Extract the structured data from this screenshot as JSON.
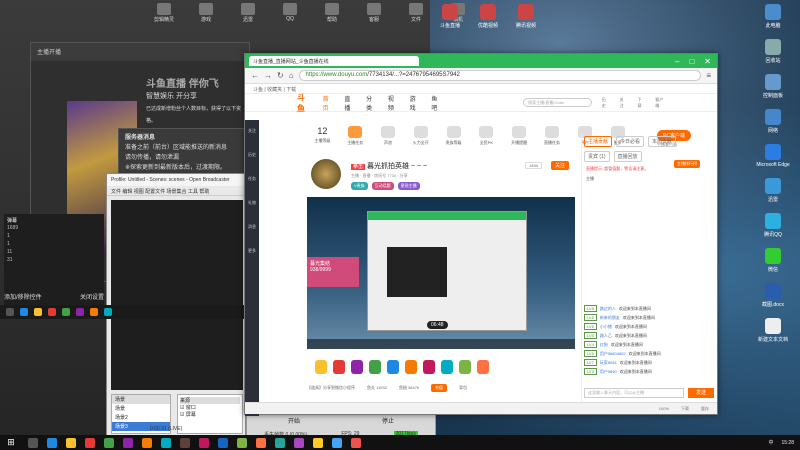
{
  "desktop": {
    "top_icons": [
      "剪辑精灵",
      "游戏",
      "迅雷",
      "QQ",
      "帮助",
      "客服",
      "文件",
      "相机",
      "直播",
      "微信"
    ],
    "right_icons": [
      "此电脑",
      "回收站",
      "控制面板",
      "网络",
      "Microsoft Edge",
      "迅雷",
      "腾讯QQ",
      "微信",
      "截图.docx",
      "新建文本文档"
    ],
    "mid_icons": [
      "斗鱼直播",
      "优酷视频",
      "腾讯视频"
    ],
    "left_icons": [
      "截图.docx",
      "新建文本文档"
    ]
  },
  "dark_window": {
    "title": "主播开播",
    "big_text": "斗鱼直播 伴你飞",
    "line1": "智慧娱乐 开分享",
    "line2": "已达成新增粉丝个人数目标，获得了以下资格。"
  },
  "notice": {
    "title": "服务器消息",
    "line1": "准备之前（前台）区域能推送的新消息",
    "line2": "请勿传播，请勿泄漏",
    "line3": "※探索更新到最新版本后，过渡期限。"
  },
  "obs": {
    "title": "Profile: Untitled - Scenes: scenes - Open Broadcaster",
    "menu": "文件  编辑  视图  配置文件  场景集合  工具  帮助",
    "scenes_header": "场景",
    "scenes": [
      "场景",
      "场景2",
      "场景3"
    ],
    "sources_header": "来源",
    "sources": [
      "窗口",
      "屏幕"
    ],
    "start_label": "开始",
    "stop_label": "停止",
    "status_time": "0:00:31 (LIVE)",
    "dropped": "丢失帧数 0 (0.00%)",
    "fps": "FPS: 29",
    "bitrate": "2017kb/s"
  },
  "left_panel": {
    "title": "弹幕",
    "rows": [
      "1689",
      "1",
      "1",
      "11",
      "31",
      "21",
      "主播"
    ],
    "buttons": [
      "添加/移除控件",
      "关闭设置"
    ]
  },
  "browser": {
    "tab_title": "斗鱼直播_直播网站_斗鱼直播在线",
    "url_host": "https://www.douyu.com",
    "url_path": "/7734134/...?=24767954695S7942",
    "bookmarks": "斗鱼 | 收藏夹 | 下载"
  },
  "site": {
    "logo": "斗鱼",
    "nav": [
      "首页",
      "直播",
      "分类",
      "视频",
      "游戏",
      "鱼吧"
    ],
    "search_placeholder": "搜索主播/直播/Order",
    "header_icons": [
      "历史",
      "关注",
      "下载",
      "客户端"
    ],
    "dock": [
      "关注",
      "历史",
      "任务",
      "礼物",
      "消息",
      "更多"
    ],
    "categories": [
      {
        "num": "12",
        "label": "主播等级"
      },
      {
        "num": "",
        "label": "主播任务"
      },
      {
        "num": "",
        "label": "声浪"
      },
      {
        "num": "",
        "label": "火力全开"
      },
      {
        "num": "",
        "label": "贵族等级"
      },
      {
        "num": "",
        "label": "全民PK"
      },
      {
        "num": "",
        "label": "开播提醒"
      },
      {
        "num": "",
        "label": "直播任务"
      },
      {
        "num": "",
        "label": "开户"
      },
      {
        "num": "",
        "label": "更多"
      }
    ],
    "pc_button": "PC客户端",
    "pc_sub": "主播客户端"
  },
  "room": {
    "tag": "拳击",
    "title": "暮光抓拍英雄 ~ ~ ~",
    "hot": "1494",
    "follow": "关注",
    "meta": "主播 · 直播 · 房间号 7734 · 分享",
    "badges": [
      "V贵族",
      "互动话题",
      "星锐主播"
    ],
    "badge_colors": [
      "#3aa",
      "#d04a7a",
      "#8a5ad0"
    ]
  },
  "player": {
    "overlay_title": "暮光集结",
    "overlay_count": "938/9999",
    "time": "06:48",
    "inner_clock": "15:29"
  },
  "under_player": {
    "text": "【道具】分享到微信小程序",
    "count1": "鱼丸 11932",
    "count2": "鱼翅 3647k",
    "btn1": "充值",
    "btn2": "背包"
  },
  "chat": {
    "tabs": [
      "主播贡献",
      "今日必看",
      "本周贡献",
      "贵宾 (1)",
      "直播回放"
    ],
    "rank_label": "主播排行榜",
    "notice": "直播提示: 超管值勤，警告请注意。",
    "top_user": "主播",
    "messages": [
      {
        "lv": "LV8",
        "user": "路过的人",
        "text": "欢迎来到本直播间"
      },
      {
        "lv": "LV8",
        "user": "新来的朋友",
        "text": "欢迎来到本直播间"
      },
      {
        "lv": "LV6",
        "user": "小小猪",
        "text": "欢迎来到本直播间"
      },
      {
        "lv": "LV5",
        "user": "路人乙",
        "text": "欢迎来到本直播间"
      },
      {
        "lv": "LV4",
        "user": "红狗",
        "text": "欢迎来到本直播间"
      },
      {
        "lv": "LV8",
        "user": "用户56804802",
        "text": "欢迎来到本直播间"
      },
      {
        "lv": "LV7",
        "user": "玩家8081",
        "text": "欢迎来到本直播间"
      },
      {
        "lv": "LV5",
        "user": "用户5890",
        "text": "欢迎来到本直播间"
      },
      {
        "lv": "LV3",
        "user": "小仙女",
        "text": "弹幕对话"
      }
    ],
    "input_placeholder": "这里输入聊天内容，可以@主播",
    "send_label": "发送"
  },
  "browser_status": {
    "items": [
      "100%",
      "下载",
      "缓存"
    ]
  },
  "taskbar": {
    "start": "⊞",
    "time": "15:28",
    "ime": "中",
    "icon_colors": [
      "#333",
      "#1e88e5",
      "#fbc02d",
      "#e53935",
      "#43a047",
      "#8e24aa",
      "#f57c00",
      "#00acc1",
      "#5d4037",
      "#c2185b",
      "#1565c0",
      "#7cb342",
      "#ff7043",
      "#26a69a",
      "#ab47bc",
      "#ffca28",
      "#42a5f5",
      "#ef5350"
    ]
  }
}
